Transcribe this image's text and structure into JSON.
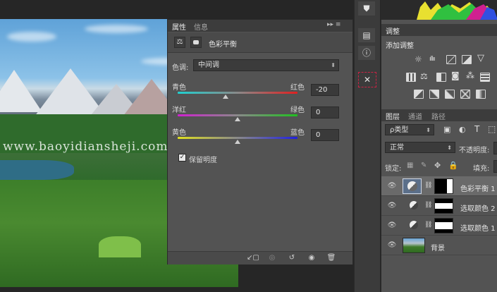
{
  "watermark": "www.baoyidiansheji.com",
  "properties_panel": {
    "tabs": [
      "属性",
      "信息"
    ],
    "header_title": "色彩平衡",
    "tone_label": "色调:",
    "tone_value": "中间调",
    "sliders": [
      {
        "left": "青色",
        "right": "红色",
        "value": "-20",
        "level": -20,
        "colors": [
          "#20d0d0",
          "#e02020"
        ]
      },
      {
        "left": "洋红",
        "right": "绿色",
        "value": "0",
        "level": 0,
        "colors": [
          "#d020d0",
          "#20c020"
        ]
      },
      {
        "left": "黄色",
        "right": "蓝色",
        "value": "0",
        "level": 0,
        "colors": [
          "#e0e020",
          "#2020e0"
        ]
      }
    ],
    "preserve_label": "保留明度",
    "preserve_checked": true,
    "menu_glyphs": "▸▸  ≡"
  },
  "adjustments_panel": {
    "tab": "调整",
    "subtitle": "添加调整"
  },
  "layers_panel": {
    "tabs": [
      "图层",
      "通道",
      "路径"
    ],
    "filter_label": "ρ类型",
    "blend_mode": "正常",
    "opacity_label": "不透明度:",
    "lock_label": "锁定:",
    "fill_label": "填充:",
    "layers": [
      {
        "name": "色彩平衡 1",
        "selected": true
      },
      {
        "name": "选取颜色 2",
        "selected": false
      },
      {
        "name": "选取颜色 1",
        "selected": false
      },
      {
        "name": "背景",
        "selected": false
      }
    ]
  },
  "colors": {
    "panel_bg": "#535353",
    "tab_bar": "#3c3c3c",
    "selected_row": "#6a6a6a"
  }
}
